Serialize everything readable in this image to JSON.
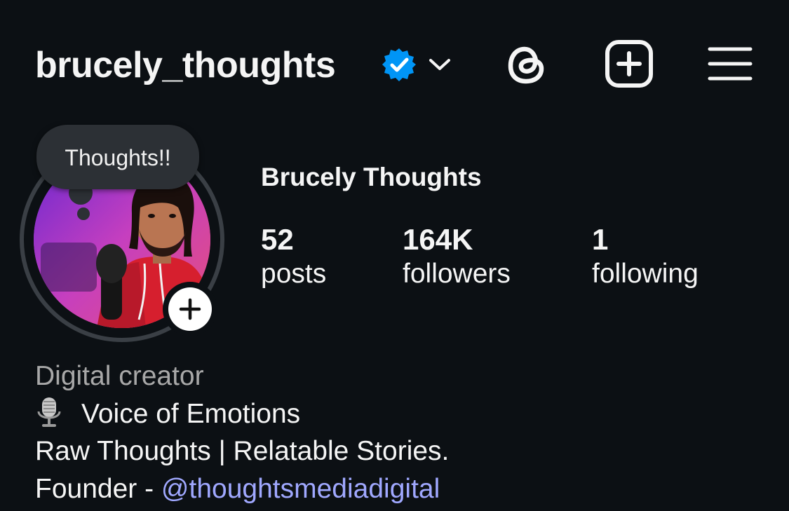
{
  "header": {
    "username": "brucely_thoughts",
    "verified_icon": "verified-badge-icon",
    "chevron_icon": "chevron-down-icon",
    "threads_icon": "threads-icon",
    "create_icon": "plus-square-icon",
    "menu_icon": "hamburger-menu-icon"
  },
  "profile": {
    "note": "Thoughts!!",
    "display_name": "Brucely Thoughts",
    "add_story_icon": "plus-icon",
    "stats": [
      {
        "value": "52",
        "label": "posts"
      },
      {
        "value": "164K",
        "label": "followers"
      },
      {
        "value": "1",
        "label": "following"
      }
    ]
  },
  "bio": {
    "category": "Digital creator",
    "mic_icon": "microphone-emoji-icon",
    "line1": "Voice of Emotions",
    "line2": "Raw Thoughts | Relatable Stories.",
    "line3_prefix": "Founder - ",
    "line3_link": "@thoughtsmediadigital"
  },
  "colors": {
    "background": "#0c1014",
    "text": "#f5f5f5",
    "muted": "#a8a8a8",
    "link": "#a0a8ff",
    "verified": "#0095f6"
  }
}
